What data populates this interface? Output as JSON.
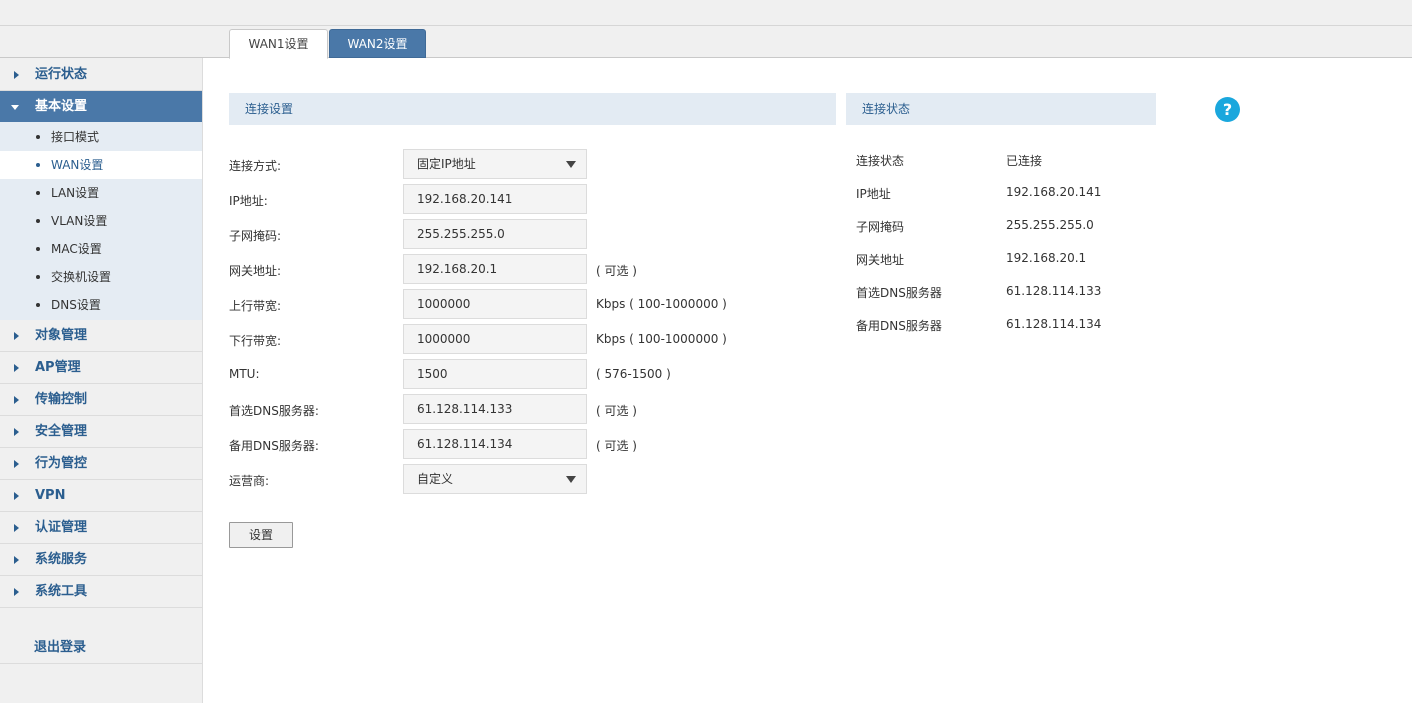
{
  "tabs": [
    {
      "label": "WAN1设置"
    },
    {
      "label": "WAN2设置"
    }
  ],
  "sidebar": {
    "items": [
      {
        "label": "运行状态"
      },
      {
        "label": "基本设置"
      },
      {
        "label": "对象管理"
      },
      {
        "label": "AP管理"
      },
      {
        "label": "传输控制"
      },
      {
        "label": "安全管理"
      },
      {
        "label": "行为管控"
      },
      {
        "label": "VPN"
      },
      {
        "label": "认证管理"
      },
      {
        "label": "系统服务"
      },
      {
        "label": "系统工具"
      }
    ],
    "sub_items": [
      {
        "label": "接口模式"
      },
      {
        "label": "WAN设置"
      },
      {
        "label": "LAN设置"
      },
      {
        "label": "VLAN设置"
      },
      {
        "label": "MAC设置"
      },
      {
        "label": "交换机设置"
      },
      {
        "label": "DNS设置"
      }
    ],
    "logout": "退出登录"
  },
  "connection": {
    "title": "连接设置",
    "rows": [
      {
        "label": "连接方式:",
        "value": "固定IP地址",
        "hint": ""
      },
      {
        "label": "IP地址:",
        "value": "192.168.20.141",
        "hint": ""
      },
      {
        "label": "子网掩码:",
        "value": "255.255.255.0",
        "hint": ""
      },
      {
        "label": "网关地址:",
        "value": "192.168.20.1",
        "hint": "( 可选 )"
      },
      {
        "label": "上行带宽:",
        "value": "1000000",
        "hint": "Kbps ( 100-1000000 )"
      },
      {
        "label": "下行带宽:",
        "value": "1000000",
        "hint": "Kbps ( 100-1000000 )"
      },
      {
        "label": "MTU:",
        "value": "1500",
        "hint": "( 576-1500 )"
      },
      {
        "label": "首选DNS服务器:",
        "value": "61.128.114.133",
        "hint": "( 可选 )"
      },
      {
        "label": "备用DNS服务器:",
        "value": "61.128.114.134",
        "hint": "( 可选 )"
      },
      {
        "label": "运营商:",
        "value": "自定义",
        "hint": ""
      }
    ],
    "button": "设置"
  },
  "status": {
    "title": "连接状态",
    "rows": [
      {
        "label": "连接状态",
        "value": "已连接"
      },
      {
        "label": "IP地址",
        "value": "192.168.20.141"
      },
      {
        "label": "子网掩码",
        "value": "255.255.255.0"
      },
      {
        "label": "网关地址",
        "value": "192.168.20.1"
      },
      {
        "label": "首选DNS服务器",
        "value": "61.128.114.133"
      },
      {
        "label": "备用DNS服务器",
        "value": "61.128.114.134"
      }
    ]
  },
  "help": {
    "icon": "question-icon",
    "glyph": "?"
  },
  "colors": {
    "accent": "#4a78a8",
    "nav_text": "#2b5e8f",
    "panel_head": "#e3ebf3",
    "help": "#1aa7dd"
  }
}
